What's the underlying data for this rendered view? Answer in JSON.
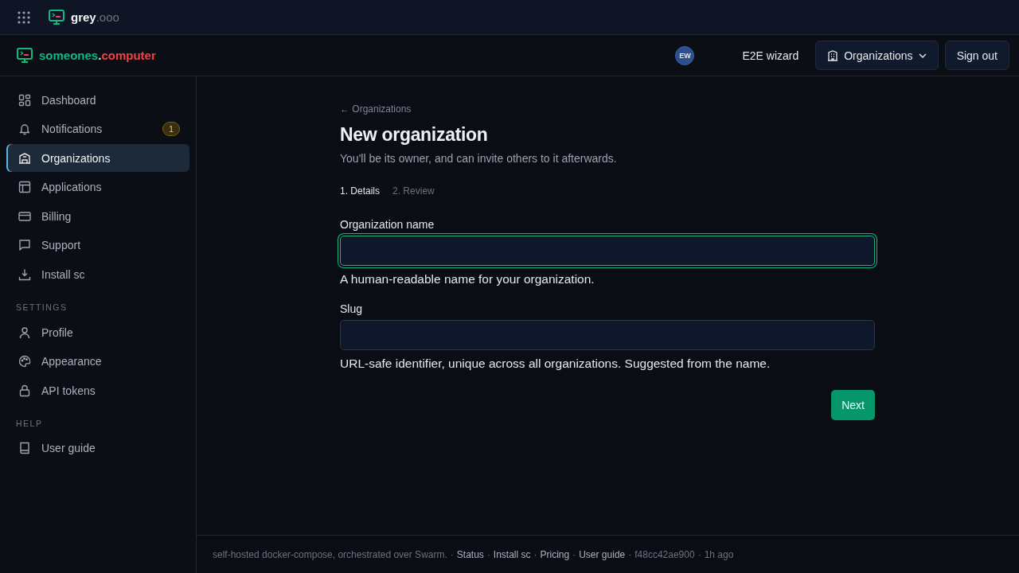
{
  "topbar": {
    "brand_name": "grey",
    "brand_suffix": ".ooo"
  },
  "header": {
    "brand_name": "someones",
    "brand_dot": ".",
    "brand_suffix": "computer",
    "avatar_initials": "EW",
    "user_name": "E2E wizard",
    "org_button": "Organizations",
    "sign_out": "Sign out"
  },
  "sidebar": {
    "sections": [
      {
        "items": [
          {
            "label": "Dashboard",
            "selected": false
          },
          {
            "label": "Notifications",
            "selected": false,
            "badge": "1"
          },
          {
            "label": "Organizations",
            "selected": true
          },
          {
            "label": "Applications",
            "selected": false
          },
          {
            "label": "Billing",
            "selected": false
          },
          {
            "label": "Support",
            "selected": false
          },
          {
            "label": "Install sc",
            "selected": false
          }
        ]
      },
      {
        "heading": "SETTINGS",
        "items": [
          {
            "label": "Profile",
            "selected": false
          },
          {
            "label": "Appearance",
            "selected": false
          },
          {
            "label": "API tokens",
            "selected": false
          }
        ]
      },
      {
        "heading": "HELP",
        "items": [
          {
            "label": "User guide",
            "selected": false
          }
        ]
      }
    ]
  },
  "page": {
    "back_link": "← Organizations",
    "title": "New organization",
    "subtitle": "You'll be its owner, and can invite others to it afterwards.",
    "steps": [
      {
        "label": "1. Details",
        "selected": true
      },
      {
        "label": "2. Review",
        "selected": false
      }
    ],
    "fields": [
      {
        "label": "Organization name",
        "focused": true,
        "help": "A human-readable name for your organization."
      },
      {
        "label": "Slug",
        "focused": false,
        "help": "URL-safe identifier, unique across all organizations. Suggested from the name."
      }
    ],
    "next_button": "Next"
  },
  "footer": {
    "note": "self-hosted docker-compose, orchestrated over Swarm.",
    "separator": "·",
    "links": [
      "Status",
      "Install sc",
      "Pricing",
      "User guide"
    ],
    "commit": "f48cc42ae900",
    "age": "1h ago"
  }
}
